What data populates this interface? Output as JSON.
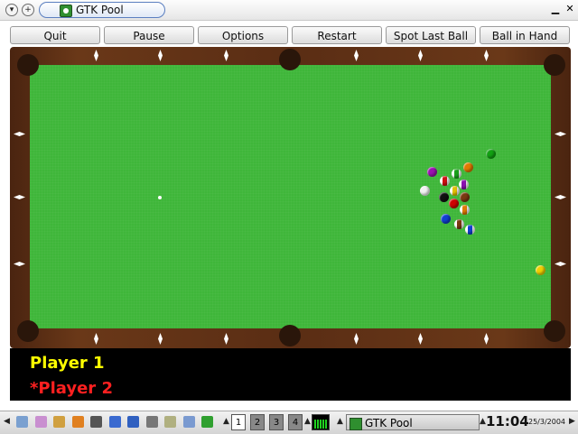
{
  "window": {
    "title": "GTK Pool"
  },
  "toolbar": {
    "quit": "Quit",
    "pause": "Pause",
    "options": "Options",
    "restart": "Restart",
    "spot_last_ball": "Spot Last Ball",
    "ball_in_hand": "Ball in Hand"
  },
  "table": {
    "felt_color": "#3fb63a",
    "rail_color": "#5a2d14",
    "balls": [
      {
        "id": "green-solid",
        "color": "#12a012",
        "stripe": false
      },
      {
        "id": "purple-solid",
        "color": "#9a10b0",
        "stripe": false
      },
      {
        "id": "orange-solid",
        "color": "#e07a00",
        "stripe": false
      },
      {
        "id": "striped-white-green",
        "color": "#1aa01a",
        "stripe": true
      },
      {
        "id": "cue-ball",
        "color": "#f2f2f2",
        "stripe": false
      },
      {
        "id": "striped-red",
        "color": "#d01010",
        "stripe": true
      },
      {
        "id": "striped-purple",
        "color": "#8a10b0",
        "stripe": true
      },
      {
        "id": "yellow-striped",
        "color": "#e0c000",
        "stripe": true
      },
      {
        "id": "black-8",
        "color": "#111111",
        "stripe": false
      },
      {
        "id": "red-solid",
        "color": "#d00000",
        "stripe": false
      },
      {
        "id": "brown-solid",
        "color": "#7a3a10",
        "stripe": false
      },
      {
        "id": "orange-striped",
        "color": "#e07a00",
        "stripe": true
      },
      {
        "id": "blue-solid",
        "color": "#1040d0",
        "stripe": false
      },
      {
        "id": "brown-striped",
        "color": "#7a3a10",
        "stripe": true
      },
      {
        "id": "blue-striped",
        "color": "#1040d0",
        "stripe": true
      },
      {
        "id": "yellow-solid",
        "color": "#f0d000",
        "stripe": false
      }
    ]
  },
  "scoreboard": {
    "player1": "Player 1",
    "player1_color": "#ffff00",
    "player2": "*Player 2",
    "player2_color": "#ff2020"
  },
  "taskbar": {
    "workspaces": [
      "1",
      "2",
      "3",
      "4"
    ],
    "active_workspace": "1",
    "task": "GTK Pool",
    "clock": "11:04",
    "date": "25/3/2004",
    "launcher_icons": [
      "gear-icon",
      "clock-icon",
      "pen-icon",
      "folder-icon",
      "printer-icon",
      "globe-icon",
      "terminal-icon",
      "search-icon",
      "tools-icon",
      "note-icon",
      "game-icon"
    ]
  }
}
